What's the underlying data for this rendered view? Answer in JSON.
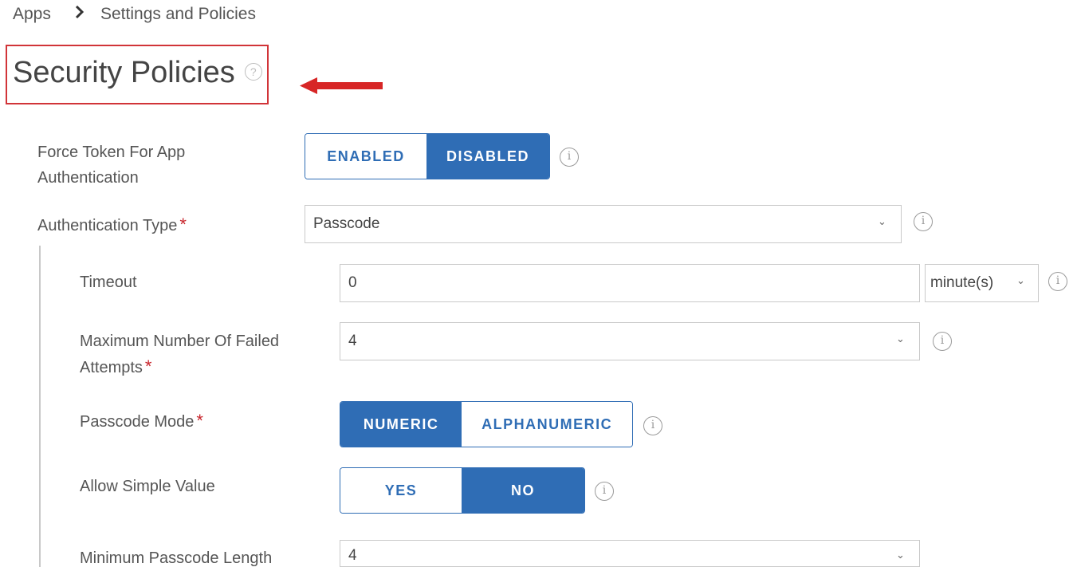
{
  "breadcrumb": {
    "root": "Apps",
    "separator": "›",
    "current": "Settings and Policies"
  },
  "page": {
    "title": "Security Policies",
    "help_glyph": "?"
  },
  "info_glyph": "i",
  "caret_glyph": "⌄",
  "required_mark": "*",
  "fields": {
    "force_token": {
      "label_line1": "Force Token For App",
      "label_line2": "Authentication",
      "options": [
        "ENABLED",
        "DISABLED"
      ],
      "selected": "DISABLED"
    },
    "auth_type": {
      "label": "Authentication Type",
      "value": "Passcode"
    },
    "timeout": {
      "label": "Timeout",
      "value": "0",
      "unit": "minute(s)"
    },
    "max_failed": {
      "label_line1": "Maximum Number Of Failed",
      "label_line2": "Attempts",
      "value": "4"
    },
    "passcode_mode": {
      "label": "Passcode Mode",
      "options": [
        "NUMERIC",
        "ALPHANUMERIC"
      ],
      "selected": "NUMERIC"
    },
    "allow_simple": {
      "label": "Allow Simple Value",
      "options": [
        "YES",
        "NO"
      ],
      "selected": "NO"
    },
    "min_length": {
      "label": "Minimum Passcode Length",
      "value": "4"
    }
  },
  "colors": {
    "accent": "#2f6db5",
    "required": "#c8252c",
    "highlight_box": "#d13438"
  }
}
